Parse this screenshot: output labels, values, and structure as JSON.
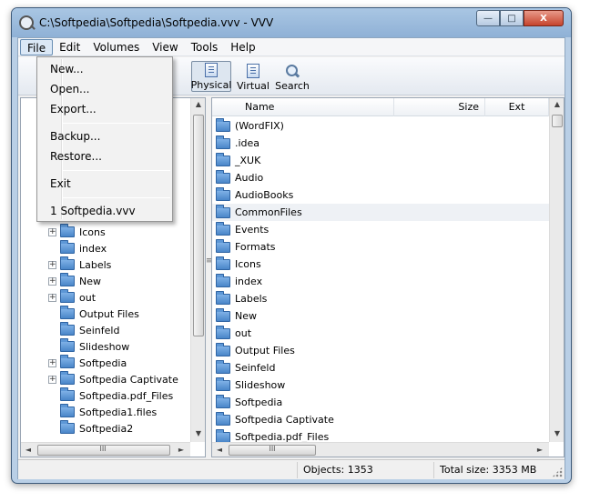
{
  "window": {
    "title": "C:\\Softpedia\\Softpedia\\Softpedia.vvv - VVV",
    "buttons": {
      "minimize": "—",
      "maximize": "□",
      "close": "X"
    }
  },
  "menubar": [
    "File",
    "Edit",
    "Volumes",
    "View",
    "Tools",
    "Help"
  ],
  "file_menu": {
    "items": [
      "New...",
      "Open...",
      "Export...",
      "Backup...",
      "Restore...",
      "Exit",
      "1 Softpedia.vvv"
    ]
  },
  "toolbar": {
    "physical": "Physical",
    "virtual": "Virtual",
    "search": "Search"
  },
  "tree": {
    "items": [
      {
        "label": "Icons",
        "expandable": true
      },
      {
        "label": "index",
        "expandable": false
      },
      {
        "label": "Labels",
        "expandable": true
      },
      {
        "label": "New",
        "expandable": true
      },
      {
        "label": "out",
        "expandable": true
      },
      {
        "label": "Output Files",
        "expandable": false
      },
      {
        "label": "Seinfeld",
        "expandable": false
      },
      {
        "label": "Slideshow",
        "expandable": false
      },
      {
        "label": "Softpedia",
        "expandable": true
      },
      {
        "label": "Softpedia Captivate",
        "expandable": true
      },
      {
        "label": "Softpedia.pdf_Files",
        "expandable": false
      },
      {
        "label": "Softpedia1.files",
        "expandable": false
      },
      {
        "label": "Softpedia2",
        "expandable": false
      }
    ],
    "expander_glyph": "+"
  },
  "columns": {
    "name": "Name",
    "size": "Size",
    "ext": "Ext"
  },
  "files": [
    "(WordFIX)",
    ".idea",
    "_XUK",
    "Audio",
    "AudioBooks",
    "CommonFiles",
    "Events",
    "Formats",
    "Icons",
    "index",
    "Labels",
    "New",
    "out",
    "Output Files",
    "Seinfeld",
    "Slideshow",
    "Softpedia",
    "Softpedia Captivate",
    "Softpedia.pdf_Files"
  ],
  "highlighted_file": "CommonFiles",
  "status": {
    "objects": "Objects: 1353",
    "total_size": "Total size: 3353 MB"
  },
  "scroll_glyphs": {
    "up": "▲",
    "down": "▼",
    "left": "◄",
    "right": "►",
    "grip_v": "≡",
    "grip_h": "III"
  },
  "colors": {
    "folder": "#4a86c8",
    "titlebar": "#a9c6e3",
    "menu_active": "#dbe8f6"
  }
}
